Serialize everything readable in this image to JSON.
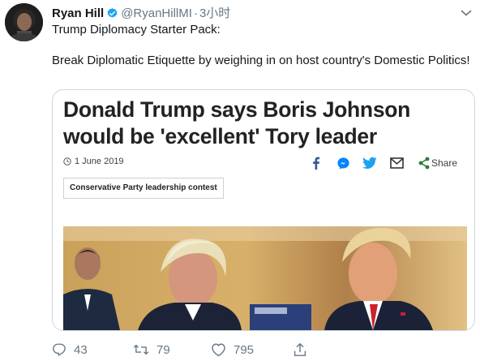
{
  "tweet": {
    "display_name": "Ryan Hill",
    "handle": "@RyanHillMI",
    "separator": "·",
    "time": "3小时",
    "line1": "Trump Diplomacy Starter Pack:",
    "line2": "Break Diplomatic Etiquette by weighing in on host country's Domestic Politics!"
  },
  "card": {
    "headline": "Donald Trump says Boris Johnson would be 'excellent' Tory leader",
    "date": "1 June 2019",
    "share_label": "Share",
    "topic": "Conservative Party leadership contest"
  },
  "actions": {
    "replies": "43",
    "retweets": "79",
    "likes": "795"
  },
  "colors": {
    "verified_blue": "#1da1f2",
    "secondary_text": "#657786",
    "facebook": "#3b5998",
    "messenger": "#0084ff",
    "twitter": "#1da1f2",
    "share_green": "#2a7d3c"
  },
  "icons": {
    "verified": "verified-badge-icon",
    "caret": "chevron-down-icon",
    "clock": "clock-icon",
    "facebook": "facebook-icon",
    "messenger": "messenger-icon",
    "twitter": "twitter-icon",
    "email": "email-icon",
    "share": "share-icon",
    "reply": "reply-icon",
    "retweet": "retweet-icon",
    "like": "heart-icon",
    "tweet_share": "upload-icon"
  }
}
